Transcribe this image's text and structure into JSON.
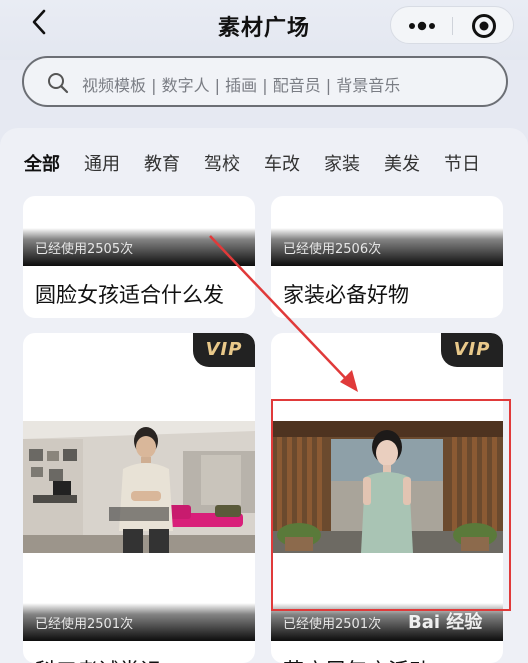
{
  "header": {
    "title": "素材广场",
    "back_icon": "chevron-left-icon",
    "more_icon": "more-dots-icon",
    "close_icon": "target-icon"
  },
  "search": {
    "placeholder": "视频模板 | 数字人 | 插画 | 配音员 | 背景音乐",
    "icon": "search-icon"
  },
  "tabs": [
    {
      "label": "全部",
      "active": true
    },
    {
      "label": "通用"
    },
    {
      "label": "教育"
    },
    {
      "label": "驾校"
    },
    {
      "label": "车改"
    },
    {
      "label": "家装"
    },
    {
      "label": "美发"
    },
    {
      "label": "节日"
    }
  ],
  "cards": [
    {
      "usage": "已经使用2505次",
      "title": "圆脸女孩适合什么发"
    },
    {
      "usage": "已经使用2506次",
      "title": "家装必备好物"
    },
    {
      "vip": "VIP",
      "usage": "已经使用2501次",
      "title": "科三考试常识"
    },
    {
      "vip": "VIP",
      "usage": "已经使用2501次",
      "title": "花店周年庆活动"
    }
  ],
  "watermark": "Bai 经验",
  "colors": {
    "accent_red": "#e03a3a",
    "vip_gold": "#e9c98a",
    "background": "#e6e9f2"
  }
}
